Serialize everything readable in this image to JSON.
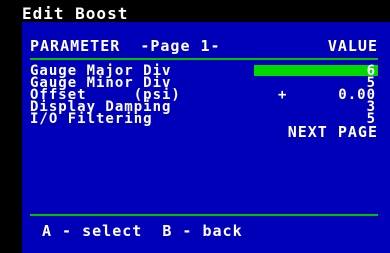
{
  "window": {
    "title": "Edit Boost"
  },
  "header": {
    "parameter_label": "PARAMETER",
    "page_label": "-Page 1-",
    "value_label": "VALUE"
  },
  "rows": [
    {
      "label": "Gauge Major Div",
      "sign": "",
      "value": "6",
      "selected": true
    },
    {
      "label": "Gauge Minor Div",
      "sign": "",
      "value": "5",
      "selected": false
    },
    {
      "label": "Offset     (psi)",
      "sign": "+",
      "value": "0.00",
      "selected": false
    },
    {
      "label": "Display Damping",
      "sign": "",
      "value": "3",
      "selected": false
    },
    {
      "label": "I/O Filtering",
      "sign": "",
      "value": "5",
      "selected": false
    }
  ],
  "next_page_label": "NEXT PAGE",
  "footer": {
    "hint": "A - select  B - back"
  },
  "colors": {
    "panel_bg": "#0000b8",
    "accent": "#00c000",
    "highlight": "#00d800",
    "text": "#ffffff"
  }
}
